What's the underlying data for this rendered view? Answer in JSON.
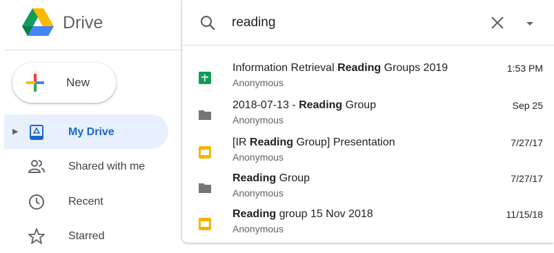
{
  "app": {
    "name": "Drive"
  },
  "new_button": {
    "label": "New"
  },
  "nav": [
    {
      "label": "My Drive",
      "active": true,
      "icon": "my-drive-icon"
    },
    {
      "label": "Shared with me",
      "active": false,
      "icon": "people-icon"
    },
    {
      "label": "Recent",
      "active": false,
      "icon": "clock-icon"
    },
    {
      "label": "Starred",
      "active": false,
      "icon": "star-icon"
    }
  ],
  "search": {
    "value": "reading",
    "results": [
      {
        "type": "sheets",
        "title_pre": "Information Retrieval ",
        "title_bold": "Reading",
        "title_post": " Groups 2019",
        "owner": "Anonymous",
        "date": "1:53 PM"
      },
      {
        "type": "folder",
        "title_pre": "2018-07-13 - ",
        "title_bold": "Reading",
        "title_post": " Group",
        "owner": "Anonymous",
        "date": "Sep 25"
      },
      {
        "type": "slides",
        "title_pre": "[IR ",
        "title_bold": "Reading",
        "title_post": " Group] Presentation",
        "owner": "Anonymous",
        "date": "7/27/17"
      },
      {
        "type": "folder",
        "title_pre": "",
        "title_bold": "Reading",
        "title_post": " Group",
        "owner": "Anonymous",
        "date": "7/27/17"
      },
      {
        "type": "slides",
        "title_pre": "",
        "title_bold": "Reading",
        "title_post": " group 15 Nov 2018",
        "owner": "Anonymous",
        "date": "11/15/18"
      }
    ]
  },
  "colors": {
    "active_text": "#1967d2",
    "active_bg": "#e8f0fe",
    "sheets_green": "#0f9d58",
    "slides_yellow": "#f4b400",
    "folder_grey": "#757575"
  }
}
